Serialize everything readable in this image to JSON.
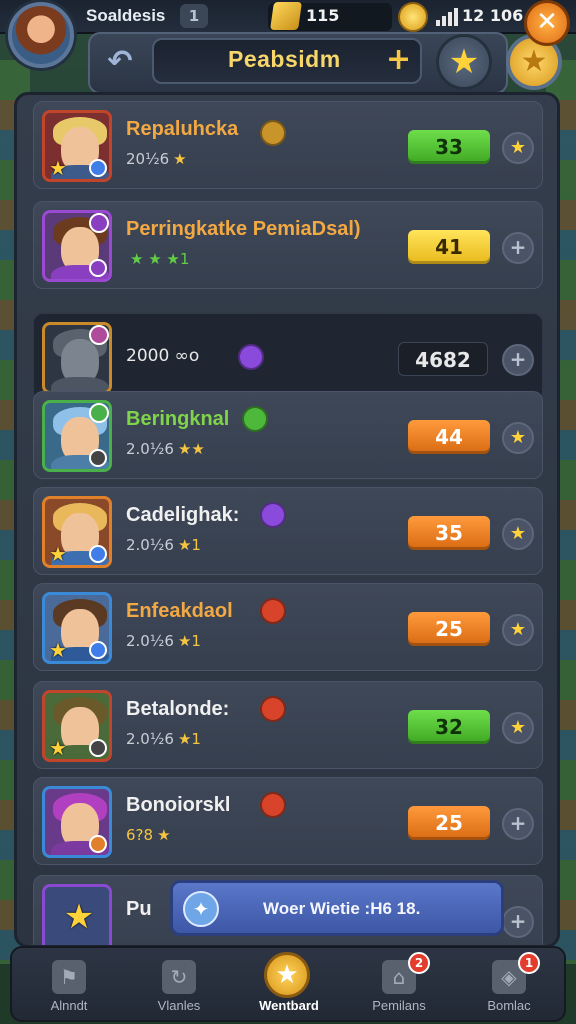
{
  "status_bar": {
    "player_name": "Soaldesis",
    "level": "1",
    "gold": "115",
    "time": "12 106"
  },
  "header": {
    "title": "Peabsidm"
  },
  "rows": [
    {
      "name": "Repaluhcka",
      "sub": "20½6",
      "stars": "★",
      "value": "33",
      "pill": "green",
      "action": "star"
    },
    {
      "name": "Perringkatke PemiaDsal)",
      "sub": "",
      "stars": "★ ★ ★1",
      "value": "41",
      "pill": "yellow",
      "action": "plus"
    },
    {
      "name": "",
      "sub": "2000 ∞o",
      "stars": "",
      "value": "4682",
      "pill": "dark",
      "action": "plus"
    },
    {
      "name": "Beringknal",
      "sub": "2.0½6",
      "stars": "★★",
      "value": "44",
      "pill": "orange",
      "action": "star"
    },
    {
      "name": "Cadelighak:",
      "sub": "2.0½6",
      "stars": "★1",
      "value": "35",
      "pill": "orange",
      "action": "star"
    },
    {
      "name": "Enfeakdaol",
      "sub": "2.0½6",
      "stars": "★1",
      "value": "25",
      "pill": "orange",
      "action": "star"
    },
    {
      "name": "Betalonde:",
      "sub": "2.0½6",
      "stars": "★1",
      "value": "32",
      "pill": "green",
      "action": "star"
    },
    {
      "name": "Bonoiorskl",
      "sub": "6?8",
      "stars": "★",
      "value": "25",
      "pill": "orange",
      "action": "plus"
    },
    {
      "name": "Pu",
      "sub": "",
      "stars": "",
      "value": "",
      "pill": "",
      "action": "plus"
    }
  ],
  "toast": {
    "text": "Woer Wietie :H6 18."
  },
  "nav": [
    {
      "label": "Alnndt",
      "badge": ""
    },
    {
      "label": "Vlanles",
      "badge": ""
    },
    {
      "label": "Wentbard",
      "badge": ""
    },
    {
      "label": "Pemilans",
      "badge": "2"
    },
    {
      "label": "Bomlac",
      "badge": "1"
    }
  ],
  "colors": {
    "accent_gold": "#f5c542",
    "pill_green": "#4fc12e",
    "pill_orange": "#f07f22",
    "pill_yellow": "#f5cf2a",
    "toast_blue": "#4b66b8"
  }
}
